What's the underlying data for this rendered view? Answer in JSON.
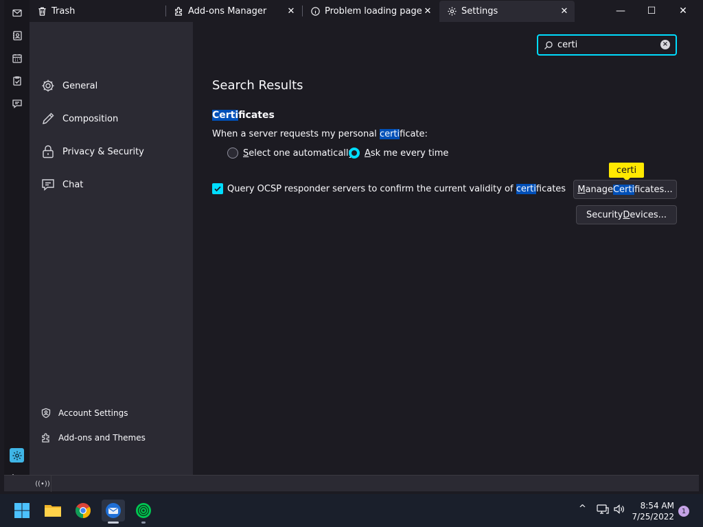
{
  "tabs": [
    {
      "label": "Trash",
      "icon": "trash-icon"
    },
    {
      "label": "Add-ons Manager",
      "icon": "puzzle-icon"
    },
    {
      "label": "Problem loading page",
      "icon": "info-icon"
    },
    {
      "label": "Settings",
      "icon": "gear-icon"
    }
  ],
  "window_controls": {
    "minimize": "—",
    "maximize": "☐",
    "close": "✕"
  },
  "sidebar": {
    "categories": [
      {
        "label": "General",
        "icon": "gear-icon"
      },
      {
        "label": "Composition",
        "icon": "pencil-icon"
      },
      {
        "label": "Privacy & Security",
        "icon": "lock-icon"
      },
      {
        "label": "Chat",
        "icon": "chat-icon"
      }
    ],
    "footer": [
      {
        "label": "Account Settings",
        "icon": "account-icon"
      },
      {
        "label": "Add-ons and Themes",
        "icon": "puzzle-icon"
      }
    ]
  },
  "search": {
    "value": "certi",
    "placeholder": ""
  },
  "main": {
    "heading": "Search Results",
    "section_title_highlight": "Certi",
    "section_title_rest": "ficates",
    "desc_before": "When a server requests my personal ",
    "desc_highlight": "certi",
    "desc_after": "ficate:",
    "radio_auto": {
      "accesskey": "S",
      "rest": "elect one automatically"
    },
    "radio_ask": {
      "accesskey": "A",
      "rest": "sk me every time"
    },
    "ocsp": {
      "before": "Query OCSP responder servers to confirm the current validity of ",
      "highlight": "certi",
      "after": "ficates"
    },
    "manage_btn": {
      "accesskey": "M",
      "mid": "anage ",
      "highlight": "Certi",
      "after": "ficates..."
    },
    "devices_btn": {
      "before": "Security ",
      "accesskey": "D",
      "after": "evices..."
    },
    "tooltip": "certi"
  },
  "status_indicator": "((•))",
  "taskbar": {
    "apps": [
      "windows-start-icon",
      "file-explorer-icon",
      "chrome-icon",
      "thunderbird-icon",
      "tor-browser-icon"
    ],
    "tray_chevron": "^",
    "time": "8:54 AM",
    "date": "7/25/2022",
    "notification_count": "1"
  },
  "colors": {
    "accent": "#00ddff",
    "highlight": "#0050b8",
    "tooltip": "#ffe900",
    "sidebar": "#2b2a33",
    "background": "#1c1b22"
  }
}
